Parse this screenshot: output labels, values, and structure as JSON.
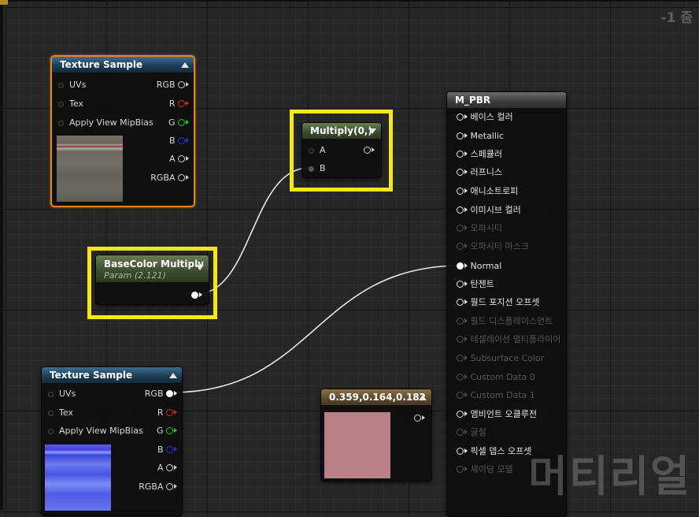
{
  "graph": {
    "zoom": "-1 줌"
  },
  "colors": {
    "highlight": "#f6e71d",
    "selected_border": "#e0881e",
    "const_swatch": "#b97f86"
  },
  "texture_sample_top": {
    "title": "Texture Sample",
    "inputs": [
      "UVs",
      "Tex",
      "Apply View MipBias"
    ],
    "outputs": [
      "RGB",
      "R",
      "G",
      "B",
      "A",
      "RGBA"
    ]
  },
  "multiply": {
    "title": "Multiply(0,)",
    "inputs": [
      "A",
      "B"
    ]
  },
  "basecolor": {
    "title": "BaseColor Multiply",
    "subtitle": "Param (2.121)"
  },
  "texture_sample_bottom": {
    "title": "Texture Sample",
    "inputs": [
      "UVs",
      "Tex",
      "Apply View MipBias"
    ],
    "outputs": [
      "RGB",
      "R",
      "G",
      "B",
      "A",
      "RGBA"
    ]
  },
  "constant": {
    "title": "0.359,0.164,0.182"
  },
  "material": {
    "title": "M_PBR",
    "pins": [
      {
        "label": "베이스 컬러",
        "enabled": true,
        "connected": false
      },
      {
        "label": "Metallic",
        "enabled": true,
        "connected": false
      },
      {
        "label": "스페큘러",
        "enabled": true,
        "connected": false
      },
      {
        "label": "러프니스",
        "enabled": true,
        "connected": false
      },
      {
        "label": "애니소트로피",
        "enabled": true,
        "connected": false
      },
      {
        "label": "이미시브 컬러",
        "enabled": true,
        "connected": false
      },
      {
        "label": "오파시티",
        "enabled": false,
        "connected": false
      },
      {
        "label": "오파시티 마스크",
        "enabled": false,
        "connected": false
      },
      {
        "label": "Normal",
        "enabled": true,
        "connected": true
      },
      {
        "label": "탄젠트",
        "enabled": true,
        "connected": false
      },
      {
        "label": "월드 포지션 오프셋",
        "enabled": true,
        "connected": false
      },
      {
        "label": "월드 디스플레이스먼트",
        "enabled": false,
        "connected": false
      },
      {
        "label": "테셀레이션 멀티플라이어",
        "enabled": false,
        "connected": false
      },
      {
        "label": "Subsurface Color",
        "enabled": false,
        "connected": false
      },
      {
        "label": "Custom Data 0",
        "enabled": false,
        "connected": false
      },
      {
        "label": "Custom Data 1",
        "enabled": false,
        "connected": false
      },
      {
        "label": "앰비언트 오클루전",
        "enabled": true,
        "connected": false
      },
      {
        "label": "굴절",
        "enabled": false,
        "connected": false
      },
      {
        "label": "픽셀 뎁스 오프셋",
        "enabled": true,
        "connected": false
      },
      {
        "label": "셰이딩 모델",
        "enabled": false,
        "connected": false
      }
    ]
  },
  "watermark": "머티리얼"
}
